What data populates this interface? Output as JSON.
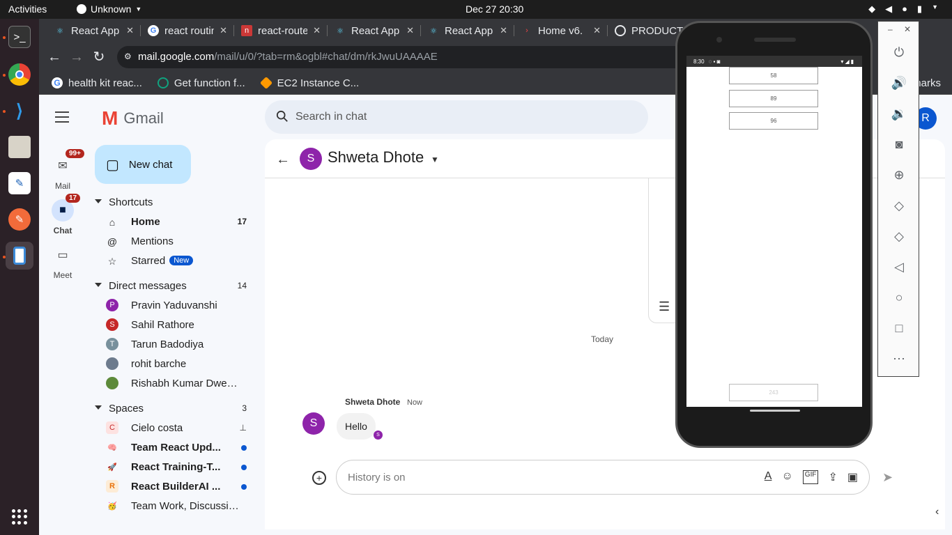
{
  "system": {
    "activities": "Activities",
    "app_menu": "Unknown",
    "clock": "Dec 27  20:30"
  },
  "browser": {
    "tabs": [
      {
        "title": "React App",
        "icon": "react-icon",
        "color": "#61dafb"
      },
      {
        "title": "react routing",
        "icon": "google-icon",
        "color": "#4285f4"
      },
      {
        "title": "react-router",
        "icon": "npm-icon",
        "color": "#cb3837"
      },
      {
        "title": "React App",
        "icon": "react-icon",
        "color": "#61dafb"
      },
      {
        "title": "React App",
        "icon": "react-icon",
        "color": "#61dafb"
      },
      {
        "title": "Home v6.",
        "icon": "redirect-icon",
        "color": "#ef4444"
      },
      {
        "title": "PRODUCT",
        "icon": "product-icon",
        "color": "#e8eaed"
      }
    ],
    "url_host": "mail.google.com",
    "url_path": "/mail/u/0/?tab=rm&ogbl#chat/dm/rkJwuUAAAAE",
    "bookmarks": [
      {
        "label": "health kit reac...",
        "icon": "google-icon",
        "color": "#4285f4"
      },
      {
        "label": "Get function f...",
        "icon": "openai-icon",
        "color": "#10a37f"
      },
      {
        "label": "EC2 Instance C...",
        "icon": "aws-icon",
        "color": "#ff9900"
      }
    ],
    "bookmarks_overflow": "marks"
  },
  "gmail": {
    "logo_text": "Gmail",
    "rail": [
      {
        "label": "Mail",
        "badge": "99+"
      },
      {
        "label": "Chat",
        "badge": "17"
      },
      {
        "label": "Meet",
        "badge": ""
      }
    ],
    "new_chat": "New chat",
    "search_placeholder": "Search in chat",
    "account_initial": "R",
    "shortcuts": {
      "title": "Shortcuts",
      "items": [
        {
          "label": "Home",
          "count": "17"
        },
        {
          "label": "Mentions",
          "count": ""
        },
        {
          "label": "Starred",
          "badge": "New"
        }
      ]
    },
    "direct_messages": {
      "title": "Direct messages",
      "count": "14",
      "items": [
        {
          "name": "Pravin Yaduvanshi",
          "initial": "P",
          "color": "#8e24aa"
        },
        {
          "name": "Sahil Rathore",
          "initial": "S",
          "color": "#c62828"
        },
        {
          "name": "Tarun Badodiya",
          "initial": "T",
          "color": "#78909c"
        },
        {
          "name": "rohit barche",
          "initial": "",
          "color": "#6d7b8d"
        },
        {
          "name": "Rishabh Kumar Dwev...",
          "initial": "",
          "color": "#5d8a3a"
        }
      ]
    },
    "spaces": {
      "title": "Spaces",
      "count": "3",
      "items": [
        {
          "name": "Cielo costa",
          "initial": "C",
          "bold": false,
          "pinned": true
        },
        {
          "name": "Team React Upd...",
          "initial": "🧠",
          "bold": true,
          "unread": true
        },
        {
          "name": "React Training-T...",
          "initial": "🚀",
          "bold": true,
          "unread": true
        },
        {
          "name": "React BuilderAI ...",
          "initial": "R",
          "bold": true,
          "unread": true
        },
        {
          "name": "Team Work, Discussio...",
          "initial": "🥳",
          "bold": false
        }
      ]
    },
    "chat": {
      "contact_initial": "S",
      "contact_name": "Shweta Dhote",
      "day_divider": "Today",
      "message": {
        "sender": "Shweta Dhote",
        "time": "Now",
        "text": "Hello",
        "read_initial": "S"
      },
      "composer_placeholder": "History is on"
    }
  },
  "emulator": {
    "status_time": "8:30",
    "values": [
      "58",
      "89",
      "96"
    ],
    "bottom_value": "243"
  }
}
